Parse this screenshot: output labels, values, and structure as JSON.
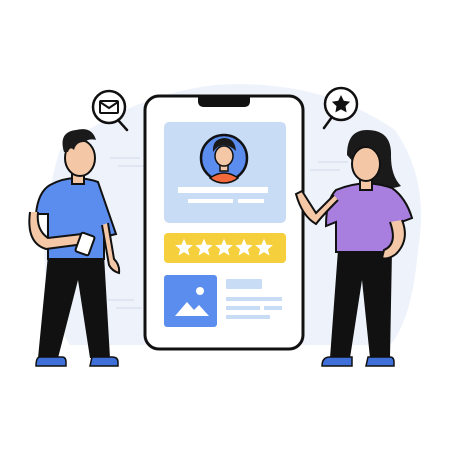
{
  "illustration": {
    "colors": {
      "outline": "#111111",
      "backdrop": "#eef3fb",
      "card_blue": "#c9dcf5",
      "accent_blue": "#5b8def",
      "shirt_blue": "#5b8def",
      "shirt_purple": "#a87ede",
      "skin": "#f4c8a6",
      "hair": "#1a1a1a",
      "pants": "#111111",
      "shoe": "#3f6fd8",
      "rating_yellow": "#f6cf3d",
      "avatar_shirt": "#f26a3c",
      "line_gray": "#c9d7ec"
    },
    "rating": {
      "stars": 5,
      "filled": 5
    },
    "icons": {
      "left_bubble": "mail-icon",
      "right_bubble": "star-icon",
      "media": "image-icon"
    }
  }
}
